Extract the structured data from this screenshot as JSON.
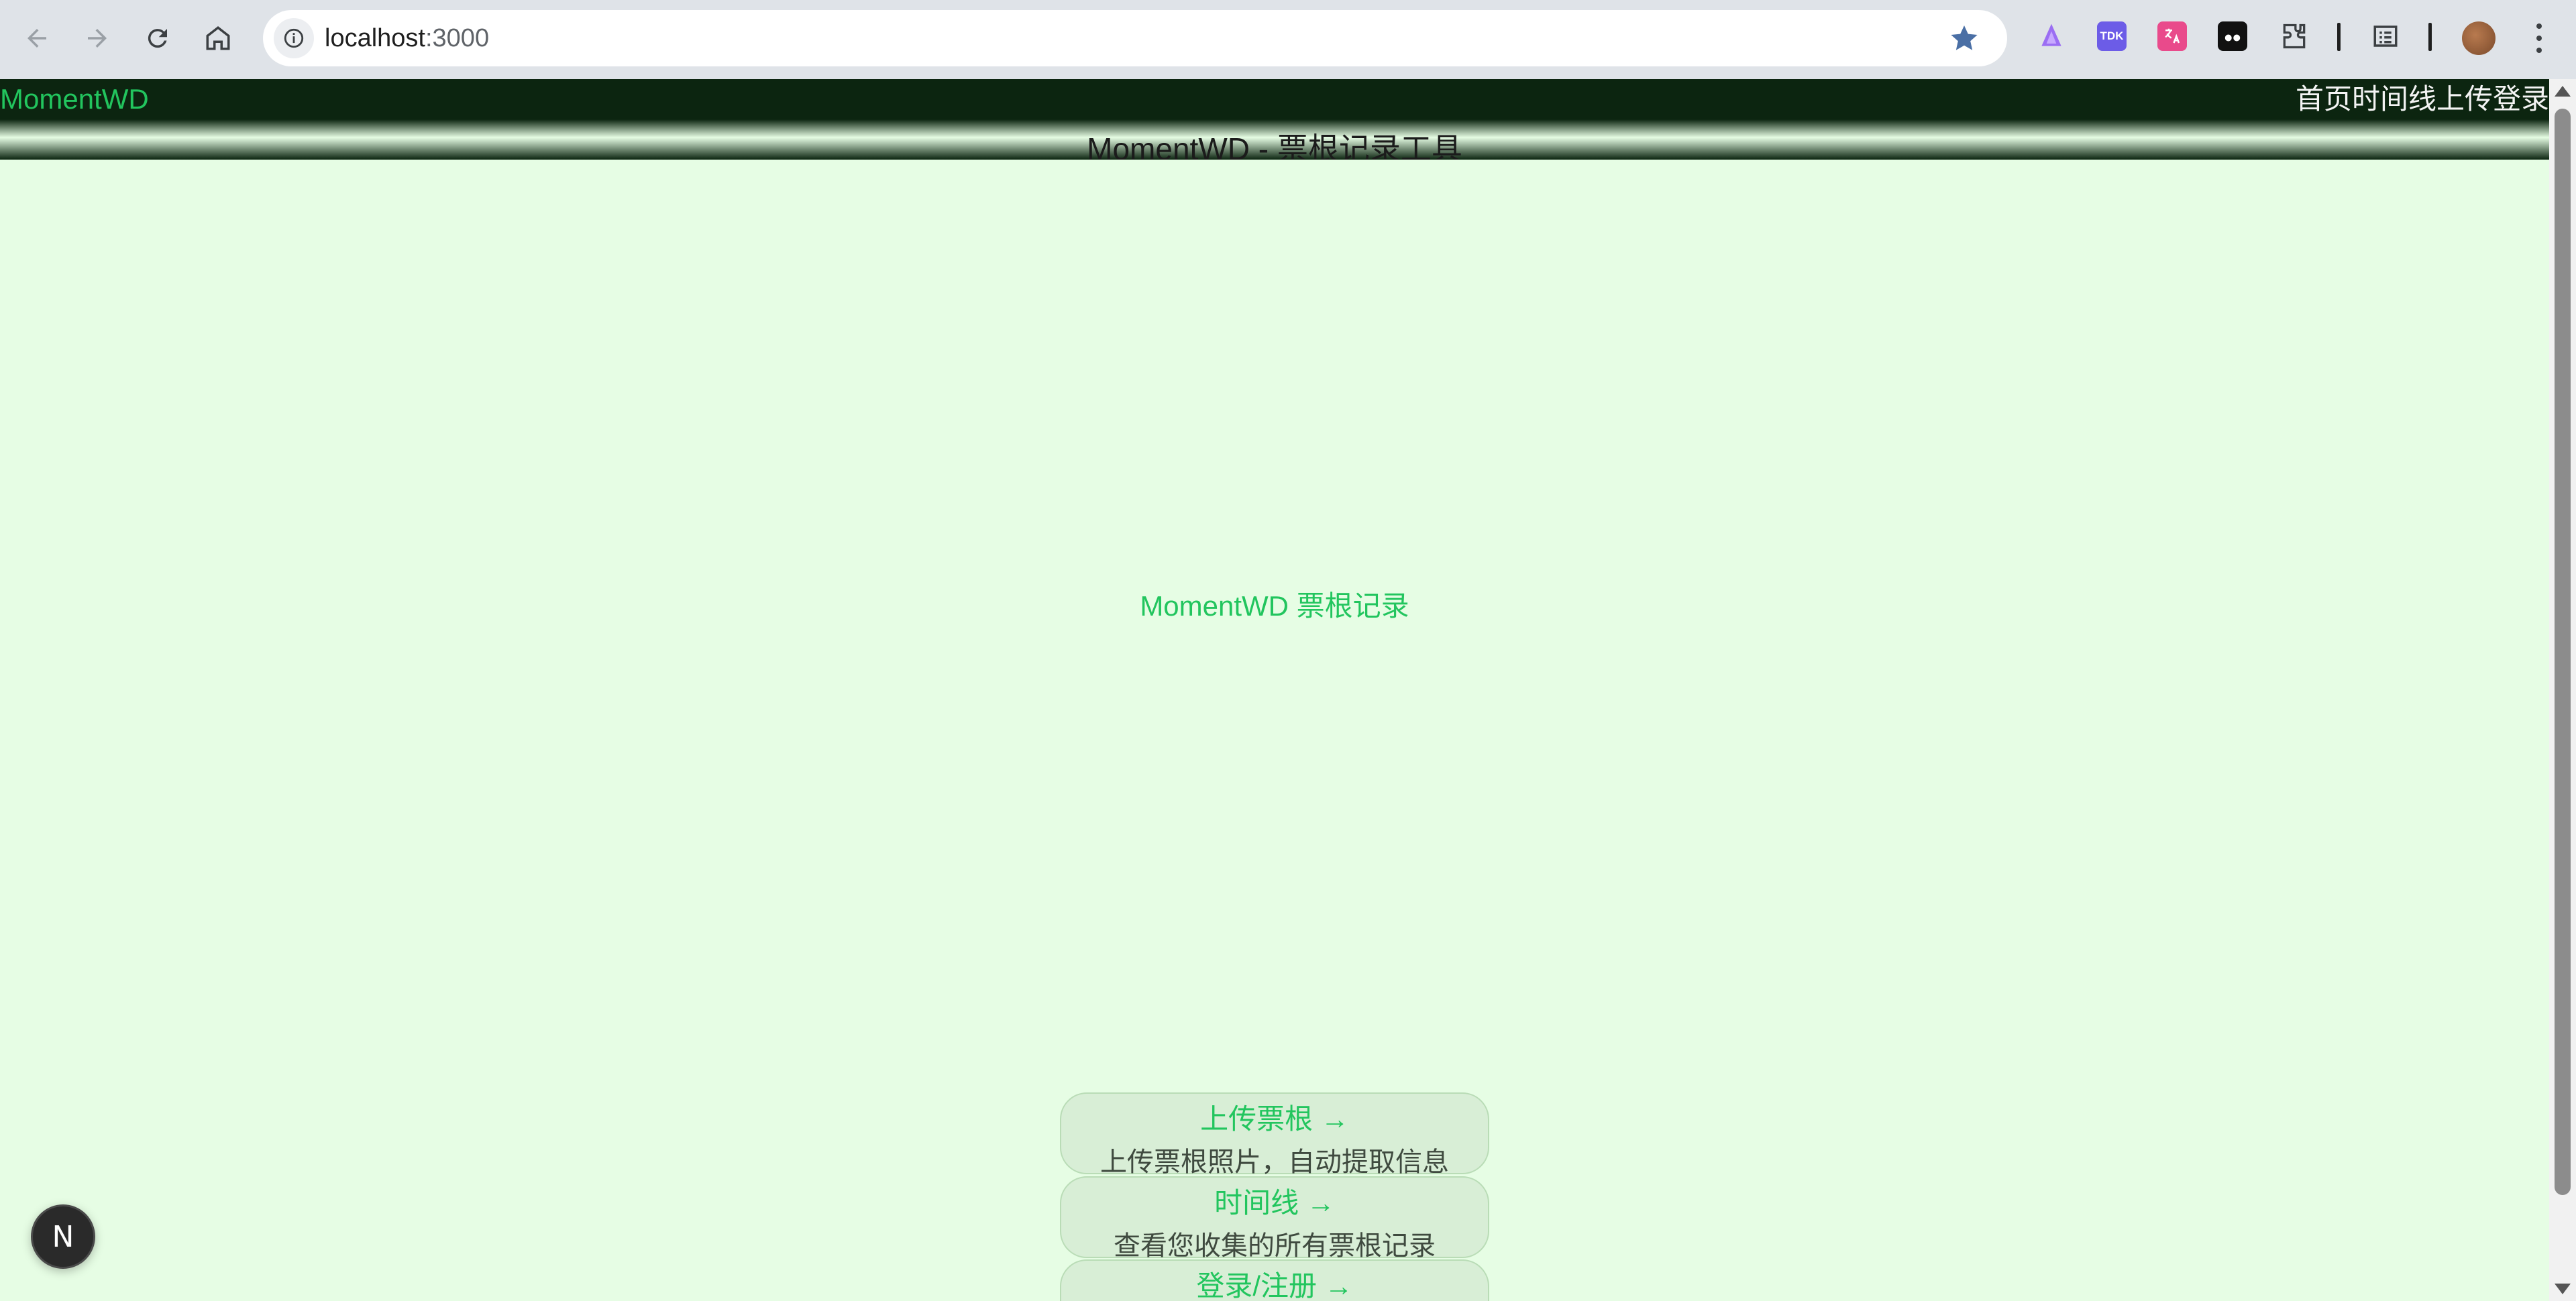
{
  "browser": {
    "url_host": "localhost",
    "url_port": ":3000",
    "extensions": [
      "TDK"
    ]
  },
  "site": {
    "brand": "MomentWD",
    "nav": [
      "首页",
      "时间线",
      "上传",
      "登录"
    ],
    "hero_band_title": "MomentWD - 票根记录工具",
    "main_title": "MomentWD 票根记录",
    "cards": [
      {
        "title": "上传票根 →",
        "desc": "上传票根照片，自动提取信息"
      },
      {
        "title": "时间线 →",
        "desc": "查看您收集的所有票根记录"
      },
      {
        "title": "登录/注册 →",
        "desc": ""
      }
    ],
    "dev_badge": "N"
  }
}
